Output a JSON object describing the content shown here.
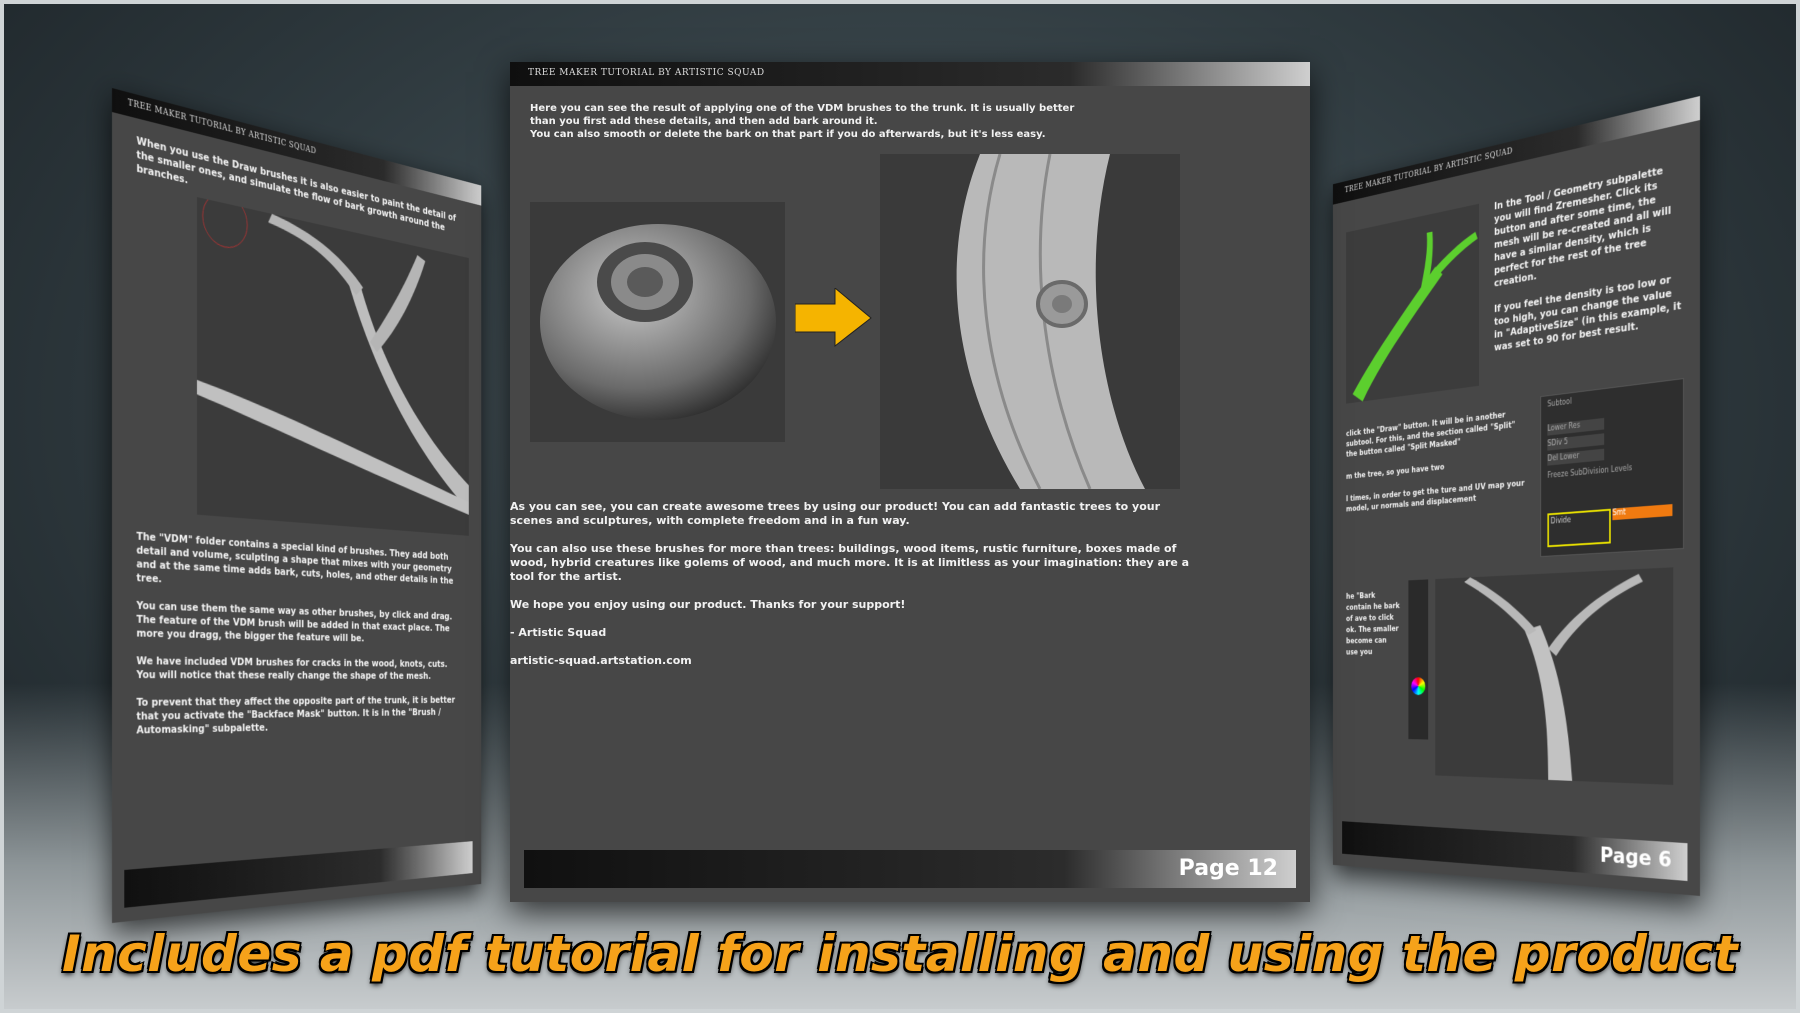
{
  "pages": {
    "left": {
      "header": "TREE MAKER TUTORIAL BY ARTISTIC SQUAD",
      "intro": "When you use the Draw brushes it is also easier to paint the detail of the smaller ones, and simulate the flow of bark growth around the branches.",
      "paragraphs": [
        "The \"VDM\" folder contains a special kind of brushes. They add both detail and volume, sculpting a shape that mixes with your geometry and at the same time adds bark, cuts, holes, and other details in the tree.",
        "You can use them the same way as other brushes, by click and drag. The feature of the VDM brush will be added in that exact place. The more you dragg, the bigger the feature will be.",
        "We have included VDM brushes for cracks in the wood, knots, cuts. You will notice that these really change the shape of the mesh.",
        "To prevent that they affect the opposite part of the trunk, it is better that you activate the \"Backface Mask\" button. It is in the \"Brush / Automasking\" subpalette."
      ]
    },
    "center": {
      "header": "TREE MAKER TUTORIAL BY ARTISTIC SQUAD",
      "intro": [
        "Here you can see the result of applying one of the VDM brushes to the trunk. It is usually better than you first add these details, and then add bark around it.",
        "You can also smooth or delete the bark on that part if you do afterwards, but it's less easy."
      ],
      "paragraphs": [
        "As you can see, you can create awesome trees by using our product! You can add fantastic trees to your scenes and sculptures, with complete freedom and in a fun way.",
        "You can also use these brushes for more than trees: buildings, wood items, rustic furniture, boxes made of wood, hybrid creatures like golems of wood, and much more. It is at limitless as your imagination: they are a tool for the artist.",
        "We hope you enjoy using our product. Thanks for your support!",
        "- Artistic Squad",
        "artistic-squad.artstation.com"
      ],
      "page_label": "Page 12"
    },
    "right": {
      "header": "TREE MAKER TUTORIAL BY ARTISTIC SQUAD",
      "paragraphs": [
        "In the Tool / Geometry subpalette you will find Zremesher. Click its button and after some time, the mesh will be re-created and all will have a similar density, which is perfect for the rest of the tree creation.",
        "If you feel the density is too low or too high, you can change the value in \"AdaptiveSize\" (in this example, it was set to 90 for best result."
      ],
      "mid_text": "click the \"Draw\" button. It will be in another subtool. For this, and the section called \"Split\" the button called \"Split Masked\"",
      "mid_text2": "m the tree, so you have two",
      "mid_text3": "l times, in order to get the ture and UV map your model, ur normals and displacement",
      "lower_text": "he \"Bark contain he bark of ave to click ok. The smaller become can use you",
      "ui_labels": [
        "Subtool",
        "Lower Res",
        "SDiv 5",
        "Del Lower",
        "Freeze SubDivision Levels",
        "Divide",
        "Smt"
      ],
      "page_label": "Page 6"
    }
  },
  "caption": "Includes a pdf tutorial for installing and using the product",
  "colors": {
    "caption": "#f6a21a",
    "arrow": "#f5b400",
    "green_mesh": "#5ccf2e",
    "highlight_box": "#e8e000"
  }
}
